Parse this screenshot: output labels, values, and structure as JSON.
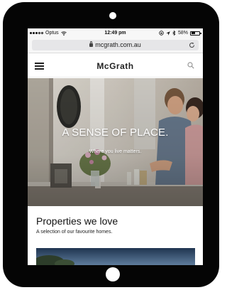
{
  "status_bar": {
    "carrier": "Optus",
    "time": "12:49 pm",
    "battery": "58%",
    "battery_level": 0.58
  },
  "browser": {
    "url": "mcgrath.com.au"
  },
  "header": {
    "logo": "McGrath",
    "menu_icon": "hamburger-menu-icon",
    "search_icon": "search-icon"
  },
  "hero": {
    "title": "A SENSE OF PLACE.",
    "subtitle": "Where you live matters."
  },
  "section": {
    "title": "Properties we love",
    "subtitle": "A selection of our favourite homes."
  },
  "colors": {
    "device": "#050505",
    "text": "#111111",
    "url_bar": "#e6e6e8"
  }
}
